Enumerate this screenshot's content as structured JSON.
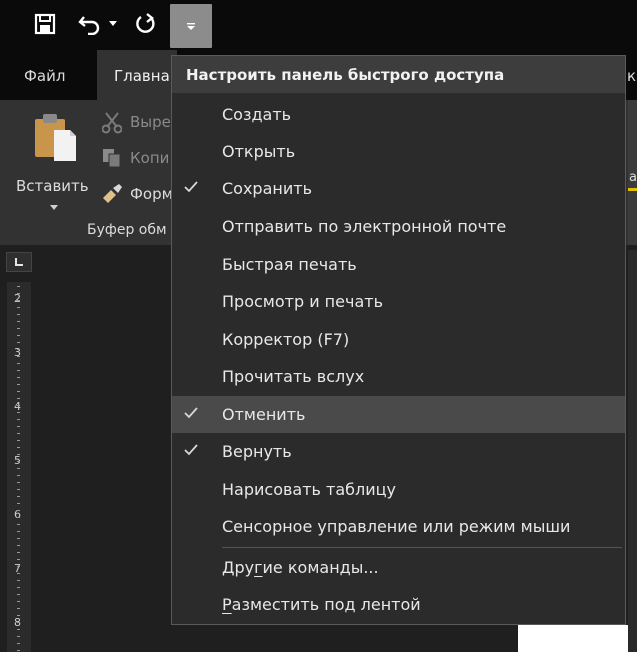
{
  "qat": {
    "icons": [
      "save-icon",
      "undo-icon",
      "dropdown-arrow-icon",
      "redo-icon",
      "customize-qat-icon"
    ]
  },
  "tabs": [
    {
      "label": "Файл"
    },
    {
      "label": "Главна"
    },
    {
      "label": "к"
    }
  ],
  "ribbon": {
    "paste_label": "Вставить",
    "cut_label": "Выре",
    "copy_label": "Копи",
    "format_label": "Форм",
    "group_label": "Буфер обм",
    "edge_label": "а"
  },
  "ruler": {
    "numbers": [
      "2",
      "3",
      "4",
      "5",
      "6",
      "7",
      "8"
    ]
  },
  "menu": {
    "header": "Настроить панель быстрого доступа",
    "items": [
      {
        "label": "Создать",
        "checked": false
      },
      {
        "label": "Открыть",
        "checked": false
      },
      {
        "label": "Сохранить",
        "checked": true
      },
      {
        "label": "Отправить по электронной почте",
        "checked": false
      },
      {
        "label": "Быстрая печать",
        "checked": false
      },
      {
        "label": "Просмотр и печать",
        "checked": false
      },
      {
        "label": "Корректор (F7)",
        "checked": false
      },
      {
        "label": "Прочитать вслух",
        "checked": false
      },
      {
        "label": "Отменить",
        "checked": true,
        "hovered": true
      },
      {
        "label": "Вернуть",
        "checked": true
      },
      {
        "label": "Нарисовать таблицу",
        "checked": false
      },
      {
        "label": "Сенсорное управление или режим мыши",
        "checked": false
      }
    ],
    "more_commands": {
      "pre": "Дру",
      "accel": "г",
      "post": "ие команды..."
    },
    "place_below": {
      "accel": "Р",
      "post": "азместить под лентой"
    }
  },
  "colors": {
    "menu_bg": "#2b2b2b",
    "menu_header_bg": "#3d3d3d",
    "menu_hover_bg": "#4a4a4a",
    "ribbon_bg": "#323232",
    "qat_customize_bg": "#8c8c8c"
  }
}
